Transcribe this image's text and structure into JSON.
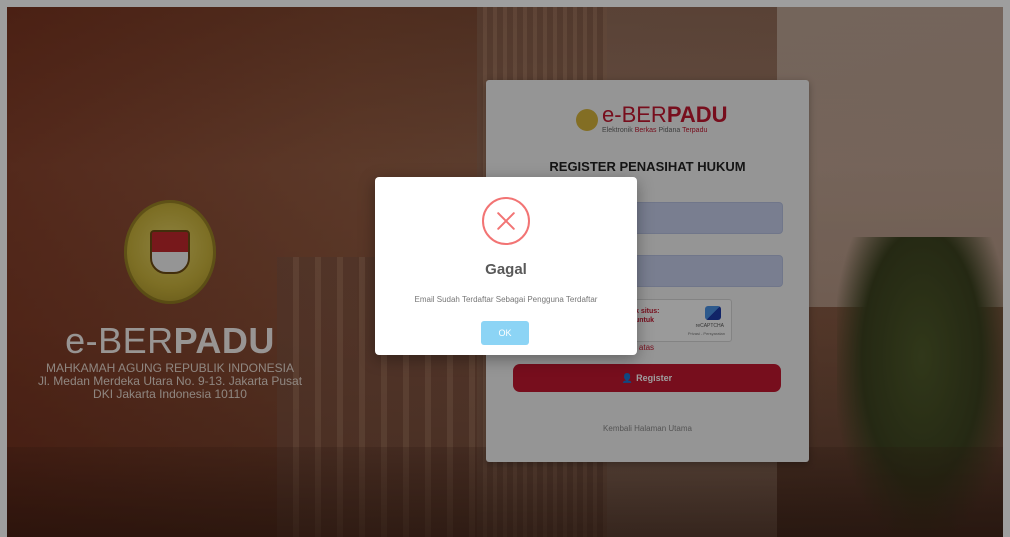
{
  "brand": {
    "title_light": "e-BER",
    "title_bold": "PADU",
    "org": "MAHKAMAH AGUNG REPUBLIK INDONESIA",
    "address1": "Jl. Medan Merdeka Utara No. 9-13. Jakarta Pusat",
    "address2": "DKI Jakarta Indonesia 10110"
  },
  "card": {
    "logo_prefix": "e-",
    "logo_light": "BER",
    "logo_bold": "PADU",
    "logo_sub_1": "Elektronik",
    "logo_sub_2": "Berkas",
    "logo_sub_3": "Pidana",
    "logo_sub_4": "Terpadu",
    "heading": "REGISTER PENASIHAT HUKUM",
    "captcha_text_1": "k situs:",
    "captcha_text_2": "untuk",
    "captcha_brand": "reCAPTCHA",
    "captcha_privacy": "Privasi - Persyaratan",
    "captcha_error": "t di atas",
    "register_label": "Register",
    "back_link": "Kembali Halaman Utama"
  },
  "modal": {
    "title": "Gagal",
    "message": "Email Sudah Terdaftar Sebagai Pengguna Terdaftar",
    "ok_label": "OK"
  },
  "colors": {
    "accent": "#c0172f",
    "error_icon": "#f27474",
    "ok_button": "#8cd4f5"
  }
}
